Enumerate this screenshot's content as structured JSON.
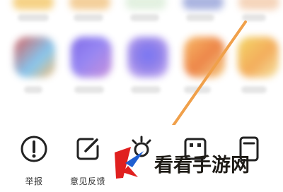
{
  "actions": [
    {
      "id": "report",
      "label": "举报",
      "icon": "alert-circle-icon"
    },
    {
      "id": "feedback",
      "label": "意见反馈",
      "icon": "edit-icon"
    },
    {
      "id": "brightness",
      "label": "",
      "icon": "brightness-icon"
    },
    {
      "id": "grid-action",
      "label": "",
      "icon": "grid-icon"
    },
    {
      "id": "document-action",
      "label": "",
      "icon": "document-icon"
    }
  ],
  "watermark": {
    "text": "看看手游网",
    "logo_text": "K"
  },
  "colors": {
    "annotation": "#f0a04a",
    "logo_red": "#e0201f",
    "logo_blue": "#1f5fd1",
    "icon_stroke": "#222222"
  }
}
